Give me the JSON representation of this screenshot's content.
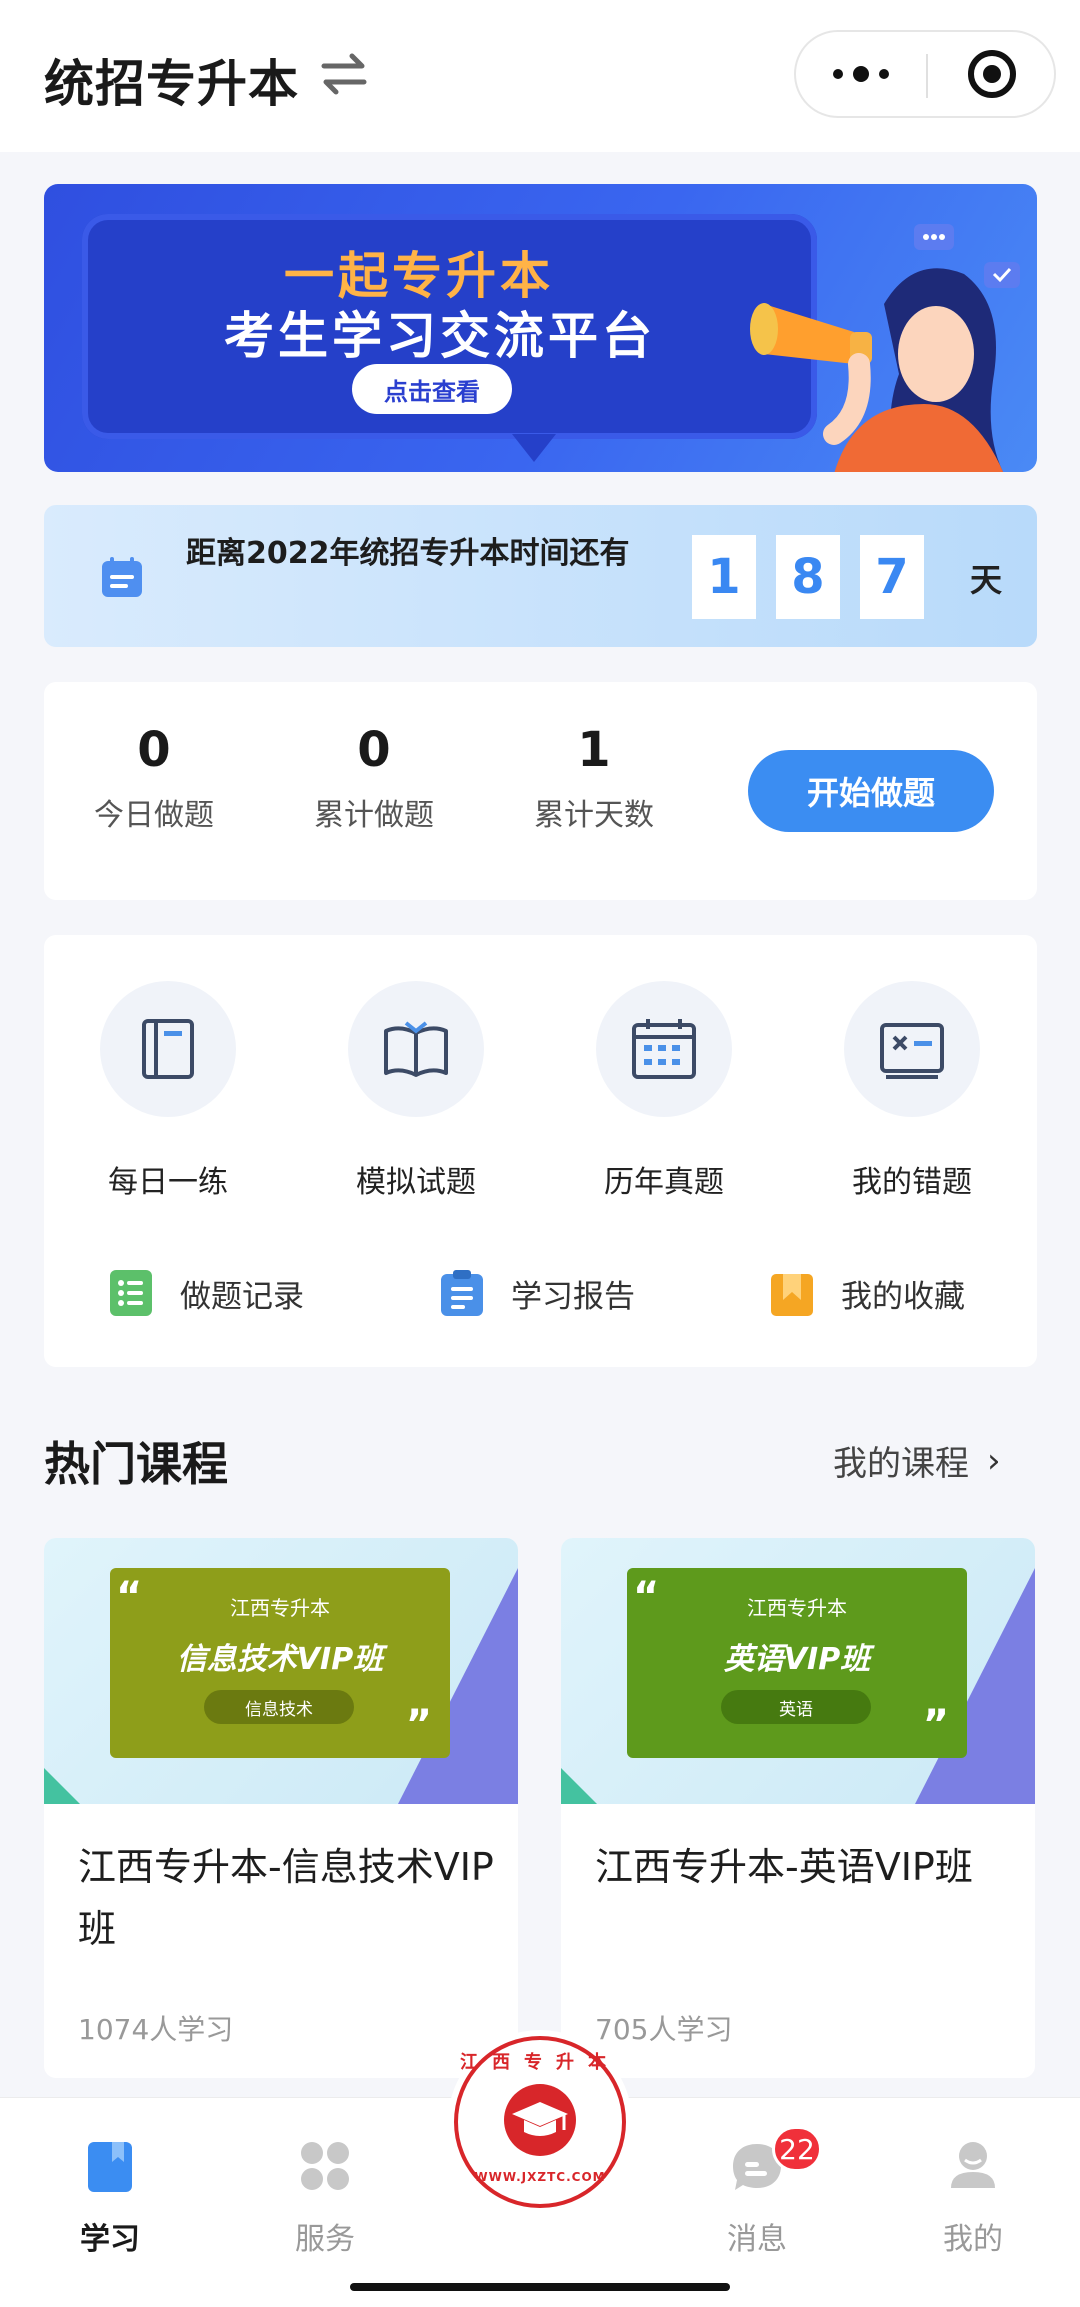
{
  "header": {
    "title": "统招专升本",
    "swap_icon": "swap-arrows-icon",
    "more_icon": "more-dots-icon",
    "close_icon": "target-circle-icon"
  },
  "banner": {
    "title": "一起专升本",
    "subtitle": "考生学习交流平台",
    "button": "点击查看",
    "colors": {
      "bg": "#3a66f0",
      "title": "#ffb347"
    }
  },
  "countdown": {
    "text": "距离2022年统招专升本时间还有",
    "digits": [
      "1",
      "8",
      "7"
    ],
    "unit": "天"
  },
  "stats": {
    "items": [
      {
        "value": "0",
        "label": "今日做题"
      },
      {
        "value": "0",
        "label": "累计做题"
      },
      {
        "value": "1",
        "label": "累计天数"
      }
    ],
    "start_button": "开始做题",
    "accent": "#3b8df2"
  },
  "features": {
    "main": [
      {
        "label": "每日一练",
        "icon": "notebook-icon"
      },
      {
        "label": "模拟试题",
        "icon": "open-book-icon"
      },
      {
        "label": "历年真题",
        "icon": "calendar-icon"
      },
      {
        "label": "我的错题",
        "icon": "error-card-icon"
      }
    ],
    "sub": [
      {
        "label": "做题记录",
        "icon": "list-record-icon",
        "color": "#5cc06a"
      },
      {
        "label": "学习报告",
        "icon": "clipboard-icon",
        "color": "#4a90e8"
      },
      {
        "label": "我的收藏",
        "icon": "bookmark-icon",
        "color": "#f5a623"
      }
    ]
  },
  "hot_courses": {
    "title": "热门课程",
    "my_courses": "我的课程",
    "items": [
      {
        "cover_top": "江西专升本",
        "cover_title": "信息技术VIP班",
        "cover_tag": "信息技术",
        "title": "江西专升本-信息技术VIP班",
        "learners": "1074人学习",
        "cover_color": "#8e9e1a"
      },
      {
        "cover_top": "江西专升本",
        "cover_title": "英语VIP班",
        "cover_tag": "英语",
        "title": "江西专升本-英语VIP班",
        "learners": "705人学习",
        "cover_color": "#5e9a1c"
      }
    ]
  },
  "tabbar": {
    "tabs": [
      {
        "label": "学习",
        "icon": "study-icon",
        "active": true
      },
      {
        "label": "服务",
        "icon": "grid-service-icon",
        "active": false
      },
      {
        "label": "消息",
        "icon": "message-icon",
        "active": false
      },
      {
        "label": "我的",
        "icon": "profile-icon",
        "active": false
      }
    ],
    "message_badge": "22",
    "logo": {
      "top_text": "江西专升本",
      "bottom_text": "WWW.JXZTC.COM"
    }
  }
}
